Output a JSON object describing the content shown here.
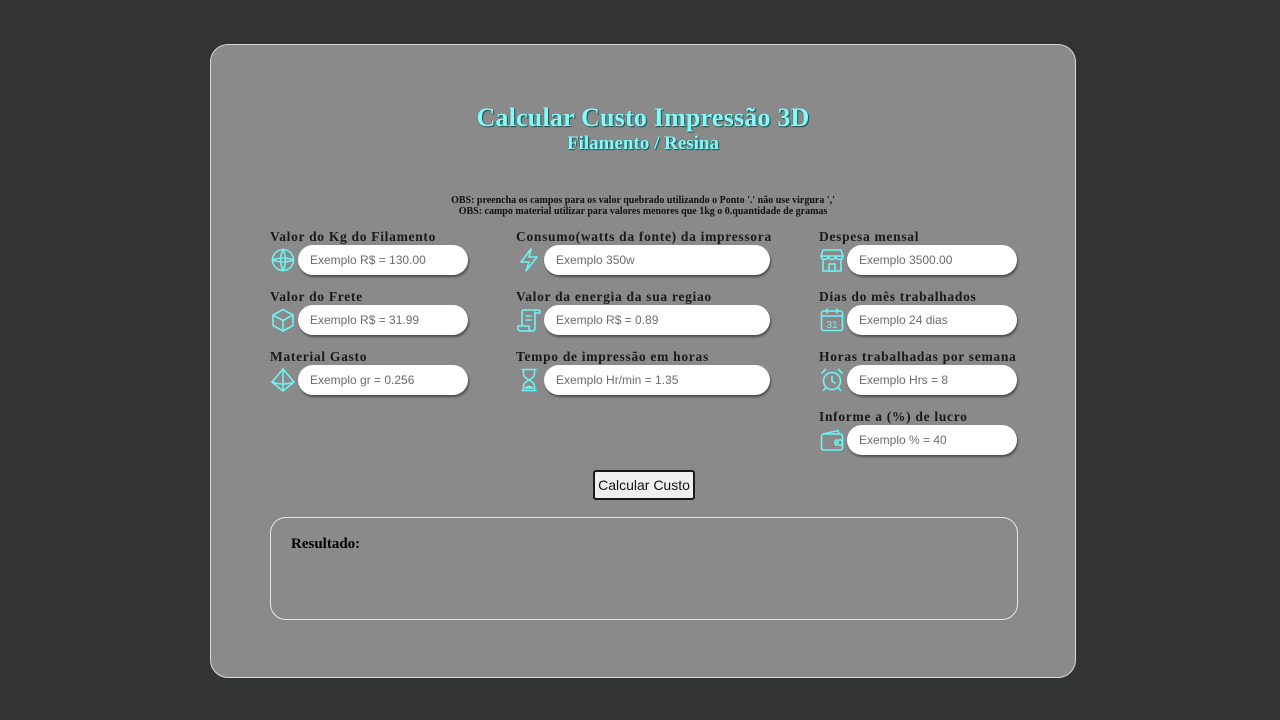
{
  "header": {
    "title": "Calcular Custo Impressão 3D",
    "subtitle": "Filamento / Resina"
  },
  "notes": {
    "obs1": "OBS: preencha os campos para os valor quebrado utilizando o Ponto '.' não use virgura ','",
    "obs2": "OBS: campo material utilizar para valores menores que 1kg o 0.quantidade de gramas"
  },
  "fields": [
    {
      "label": "Valor do Kg do Filamento",
      "placeholder": "Exemplo R$ = 130.00",
      "icon": "globe-icon"
    },
    {
      "label": "Valor do Frete",
      "placeholder": "Exemplo R$ = 31.99",
      "icon": "box-icon"
    },
    {
      "label": "Material Gasto",
      "placeholder": "Exemplo gr = 0.256",
      "icon": "prism-icon"
    },
    {
      "label": "Consumo(watts da fonte) da impressora",
      "placeholder": "Exemplo 350w",
      "icon": "lightning-icon"
    },
    {
      "label": "Valor da energia da sua regiao",
      "placeholder": "Exemplo R$ = 0.89",
      "icon": "scroll-icon"
    },
    {
      "label": "Tempo de impressão em horas",
      "placeholder": "Exemplo Hr/min = 1.35",
      "icon": "hourglass-icon"
    },
    {
      "label": "Despesa mensal",
      "placeholder": "Exemplo 3500.00",
      "icon": "store-icon"
    },
    {
      "label": "Dias do mês trabalhados",
      "placeholder": "Exemplo 24 dias",
      "icon": "calendar-icon",
      "icon_text": "31"
    },
    {
      "label": "Horas trabalhadas por semana",
      "placeholder": "Exemplo Hrs = 8",
      "icon": "alarm-clock-icon"
    },
    {
      "label": "Informe a (%) de lucro",
      "placeholder": "Exemplo % = 40",
      "icon": "wallet-icon"
    }
  ],
  "button": {
    "label": "Calcular Custo"
  },
  "result": {
    "label": "Resultado:"
  },
  "colors": {
    "page_bg": "#323333",
    "card_bg": "#8a8a8a",
    "accent": "#8af7f7",
    "icon": "#6ff2f2"
  }
}
